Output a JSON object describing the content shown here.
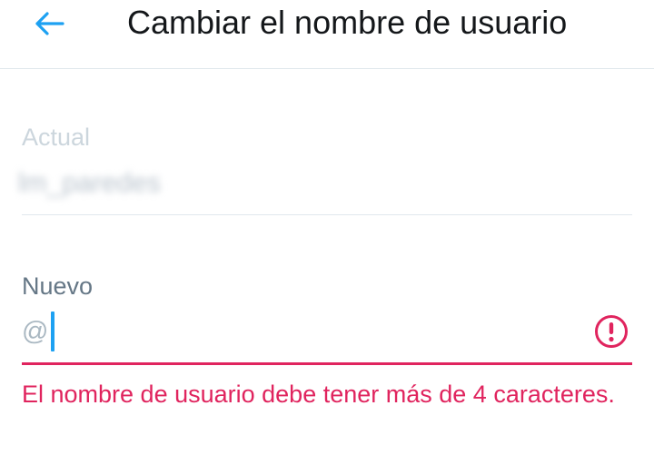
{
  "header": {
    "back_icon": "arrow-left-icon",
    "title": "Cambiar el nombre de usuario"
  },
  "current": {
    "label": "Actual",
    "value": "lm_paredes"
  },
  "new": {
    "label": "Nuevo",
    "prefix": "@",
    "value": "",
    "error_icon": "exclamation-circle-icon"
  },
  "error": {
    "message": "El nombre de usuario debe tener más de 4 caracteres."
  },
  "colors": {
    "accent": "#1da1f2",
    "error": "#e0245e",
    "divider": "#e1e8ed",
    "label_muted": "#657786"
  }
}
